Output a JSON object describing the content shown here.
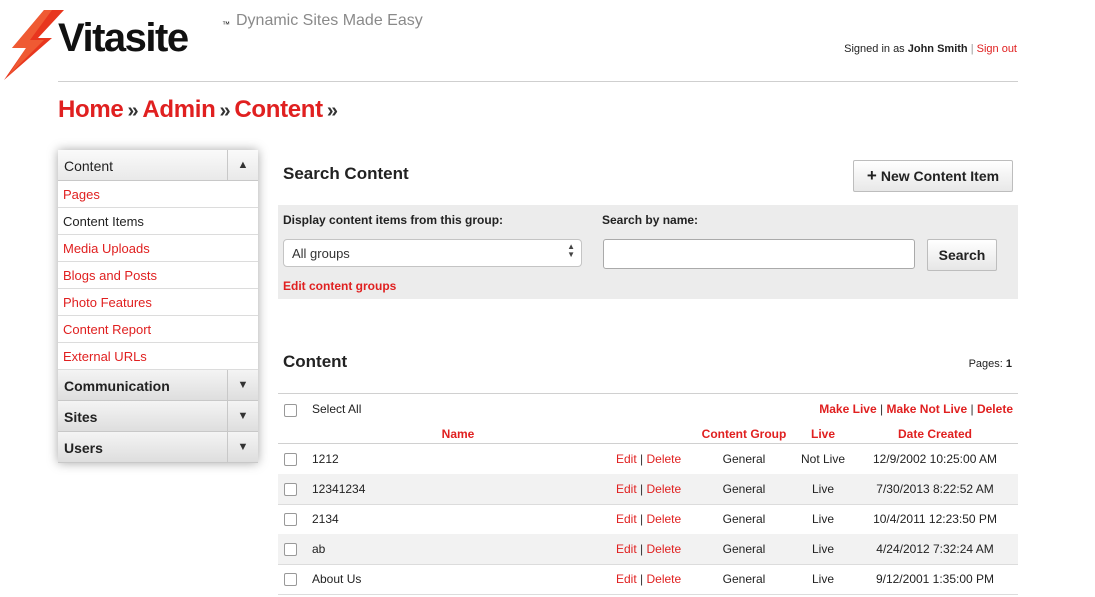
{
  "header": {
    "logo_text": "Vitasite",
    "logo_tm": "™",
    "tagline": "Dynamic Sites Made Easy",
    "signed_in_prefix": "Signed in as",
    "user_name": "John Smith",
    "separator": "|",
    "sign_out_label": "Sign out"
  },
  "breadcrumb": {
    "items": [
      "Home",
      "Admin",
      "Content"
    ],
    "separator": "»"
  },
  "sidebar": {
    "sections": [
      {
        "label": "Content",
        "arrow": "▲",
        "items": [
          {
            "label": "Pages"
          },
          {
            "label": "Content Items",
            "active": true
          },
          {
            "label": "Media Uploads"
          },
          {
            "label": "Blogs and Posts"
          },
          {
            "label": "Photo Features"
          },
          {
            "label": "Content Report"
          },
          {
            "label": "External URLs"
          }
        ]
      },
      {
        "label": "Communication",
        "arrow": "▼"
      },
      {
        "label": "Sites",
        "arrow": "▼"
      },
      {
        "label": "Users",
        "arrow": "▼"
      }
    ]
  },
  "search": {
    "title": "Search Content",
    "new_button_label": "New Content Item",
    "new_button_icon": "+",
    "group_label": "Display content items from this group:",
    "group_selected": "All groups",
    "name_label": "Search by name:",
    "name_value": "",
    "search_button_label": "Search",
    "edit_groups_label": "Edit content groups"
  },
  "content": {
    "title": "Content",
    "pages_label": "Pages:",
    "pages_value": "1",
    "select_all_label": "Select All",
    "bulk_actions": [
      "Make Live",
      "Make Not Live",
      "Delete"
    ],
    "columns": [
      "Name",
      "Content Group",
      "Live",
      "Date Created"
    ],
    "edit_label": "Edit",
    "delete_label": "Delete",
    "action_sep": "|",
    "rows": [
      {
        "name": "1212",
        "group": "General",
        "live": "Not Live",
        "date": "12/9/2002 10:25:00 AM"
      },
      {
        "name": "12341234",
        "group": "General",
        "live": "Live",
        "date": "7/30/2013 8:22:52 AM"
      },
      {
        "name": "2134",
        "group": "General",
        "live": "Live",
        "date": "10/4/2011 12:23:50 PM"
      },
      {
        "name": "ab",
        "group": "General",
        "live": "Live",
        "date": "4/24/2012 7:32:24 AM"
      },
      {
        "name": "About Us",
        "group": "General",
        "live": "Live",
        "date": "9/12/2001 1:35:00 PM"
      }
    ]
  },
  "colors": {
    "accent": "#e02020",
    "panel_bg": "#ececec"
  }
}
